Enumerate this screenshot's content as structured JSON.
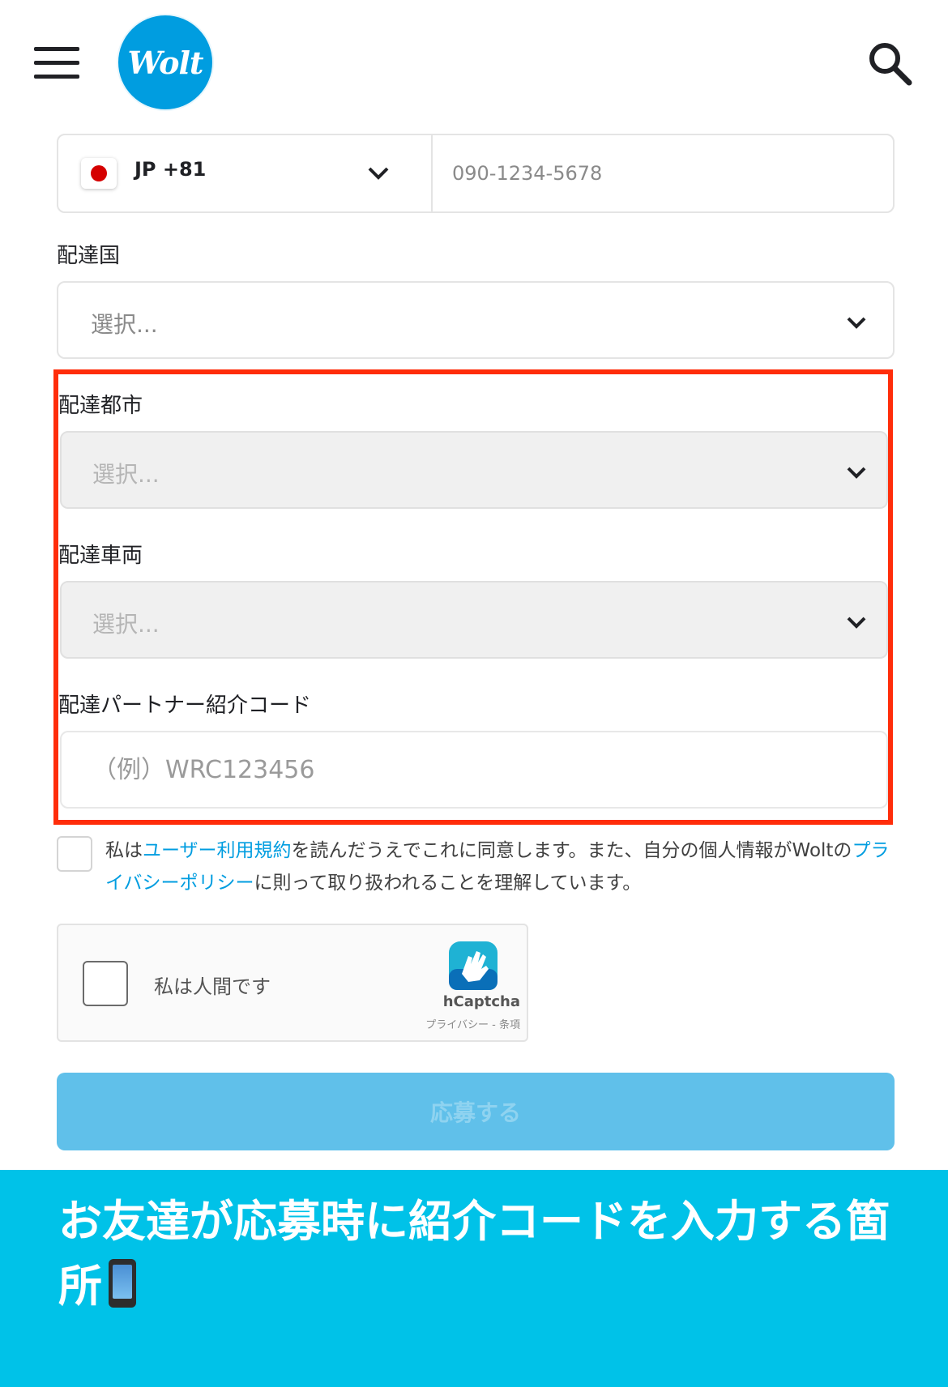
{
  "header": {
    "logo_text": "Wolt",
    "brand_color": "#009de0"
  },
  "phone": {
    "country_code_label": "JP +81",
    "number_placeholder": "090-1234-5678"
  },
  "fields": {
    "delivery_country": {
      "label": "配達国",
      "placeholder": "選択..."
    },
    "delivery_city": {
      "label": "配達都市",
      "placeholder": "選択..."
    },
    "delivery_vehicle": {
      "label": "配達車両",
      "placeholder": "選択..."
    },
    "referral_code": {
      "label": "配達パートナー紹介コード",
      "placeholder": "（例）WRC123456"
    }
  },
  "terms": {
    "prefix": "私は",
    "terms_link": "ユーザー利用規約",
    "middle": "を読んだうえでこれに同意します。また、自分の個人情報がWoltの",
    "privacy_link": "プライバシーポリシー",
    "suffix": "に則って取り扱われることを理解しています。"
  },
  "captcha": {
    "label": "私は人間です",
    "brand": "hCaptcha",
    "links": "プライバシー - 条項"
  },
  "submit": {
    "label": "応募する"
  },
  "annotation": {
    "text": "お友達が応募時に紹介コードを入力する箇所",
    "highlight_color": "#ff2d0a",
    "banner_color": "#00c2e8",
    "emoji_icon": "mobile-phone-icon"
  }
}
